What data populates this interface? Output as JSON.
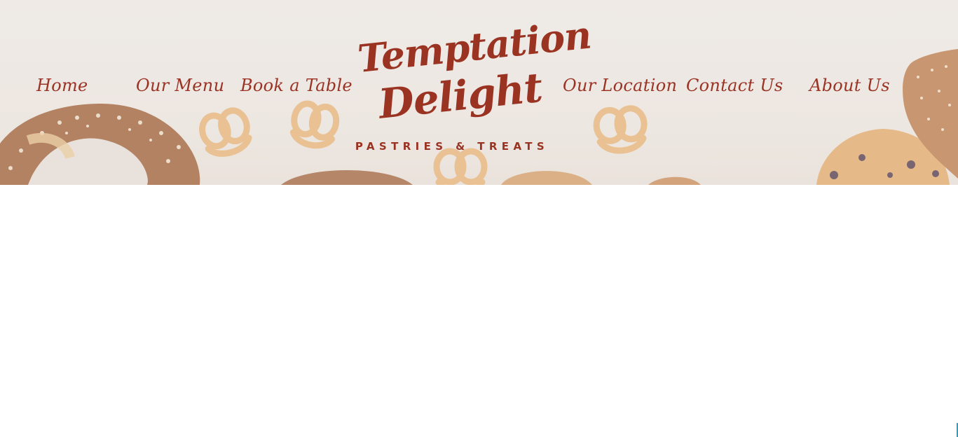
{
  "nav": {
    "home": "Home",
    "menu": "Our Menu",
    "book": "Book a Table",
    "location": "Our Location",
    "contact": "Contact Us",
    "about": "About Us"
  },
  "logo": {
    "line1": "Temptation",
    "line2": "Delight",
    "tagline": "PASTRIES & TREATS"
  },
  "colors": {
    "brand": "#9a3324",
    "header_background": "#efebe7",
    "pretzel": "#e6b272",
    "baked_brown": "#9a5a32"
  },
  "icons": {
    "background": "pastries-background-image"
  }
}
